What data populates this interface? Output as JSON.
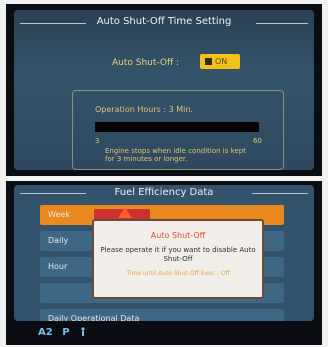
{
  "top_screen": {
    "title": "Auto Shut-Off Time Setting",
    "auto_shutoff_label": "Auto Shut-Off :",
    "auto_shutoff_value": "ON",
    "operation_hours_label": "Operation Hours :  3 Min.",
    "range_min": "3",
    "range_max": "60",
    "note": "Engine stops when idle condition is kept for 3 minutes or longer."
  },
  "bottom_screen": {
    "title": "Fuel Efficiency Data",
    "menu_items": [
      "Week",
      "Daily",
      "Hour",
      "",
      "Daily Operational Data"
    ],
    "dialog": {
      "title": "Auto Shut-Off",
      "message": "Please operate it if you want to disable Auto Shut-Off",
      "footer": "Time until Auto Shut-Off Exec : Off"
    },
    "status": {
      "mode": "A2",
      "gear": "P"
    }
  },
  "colors": {
    "accent_orange": "#e8881d",
    "warning_red": "#ff5a2a",
    "badge_yellow": "#f2c21b",
    "screen_blue": "#32536b"
  }
}
